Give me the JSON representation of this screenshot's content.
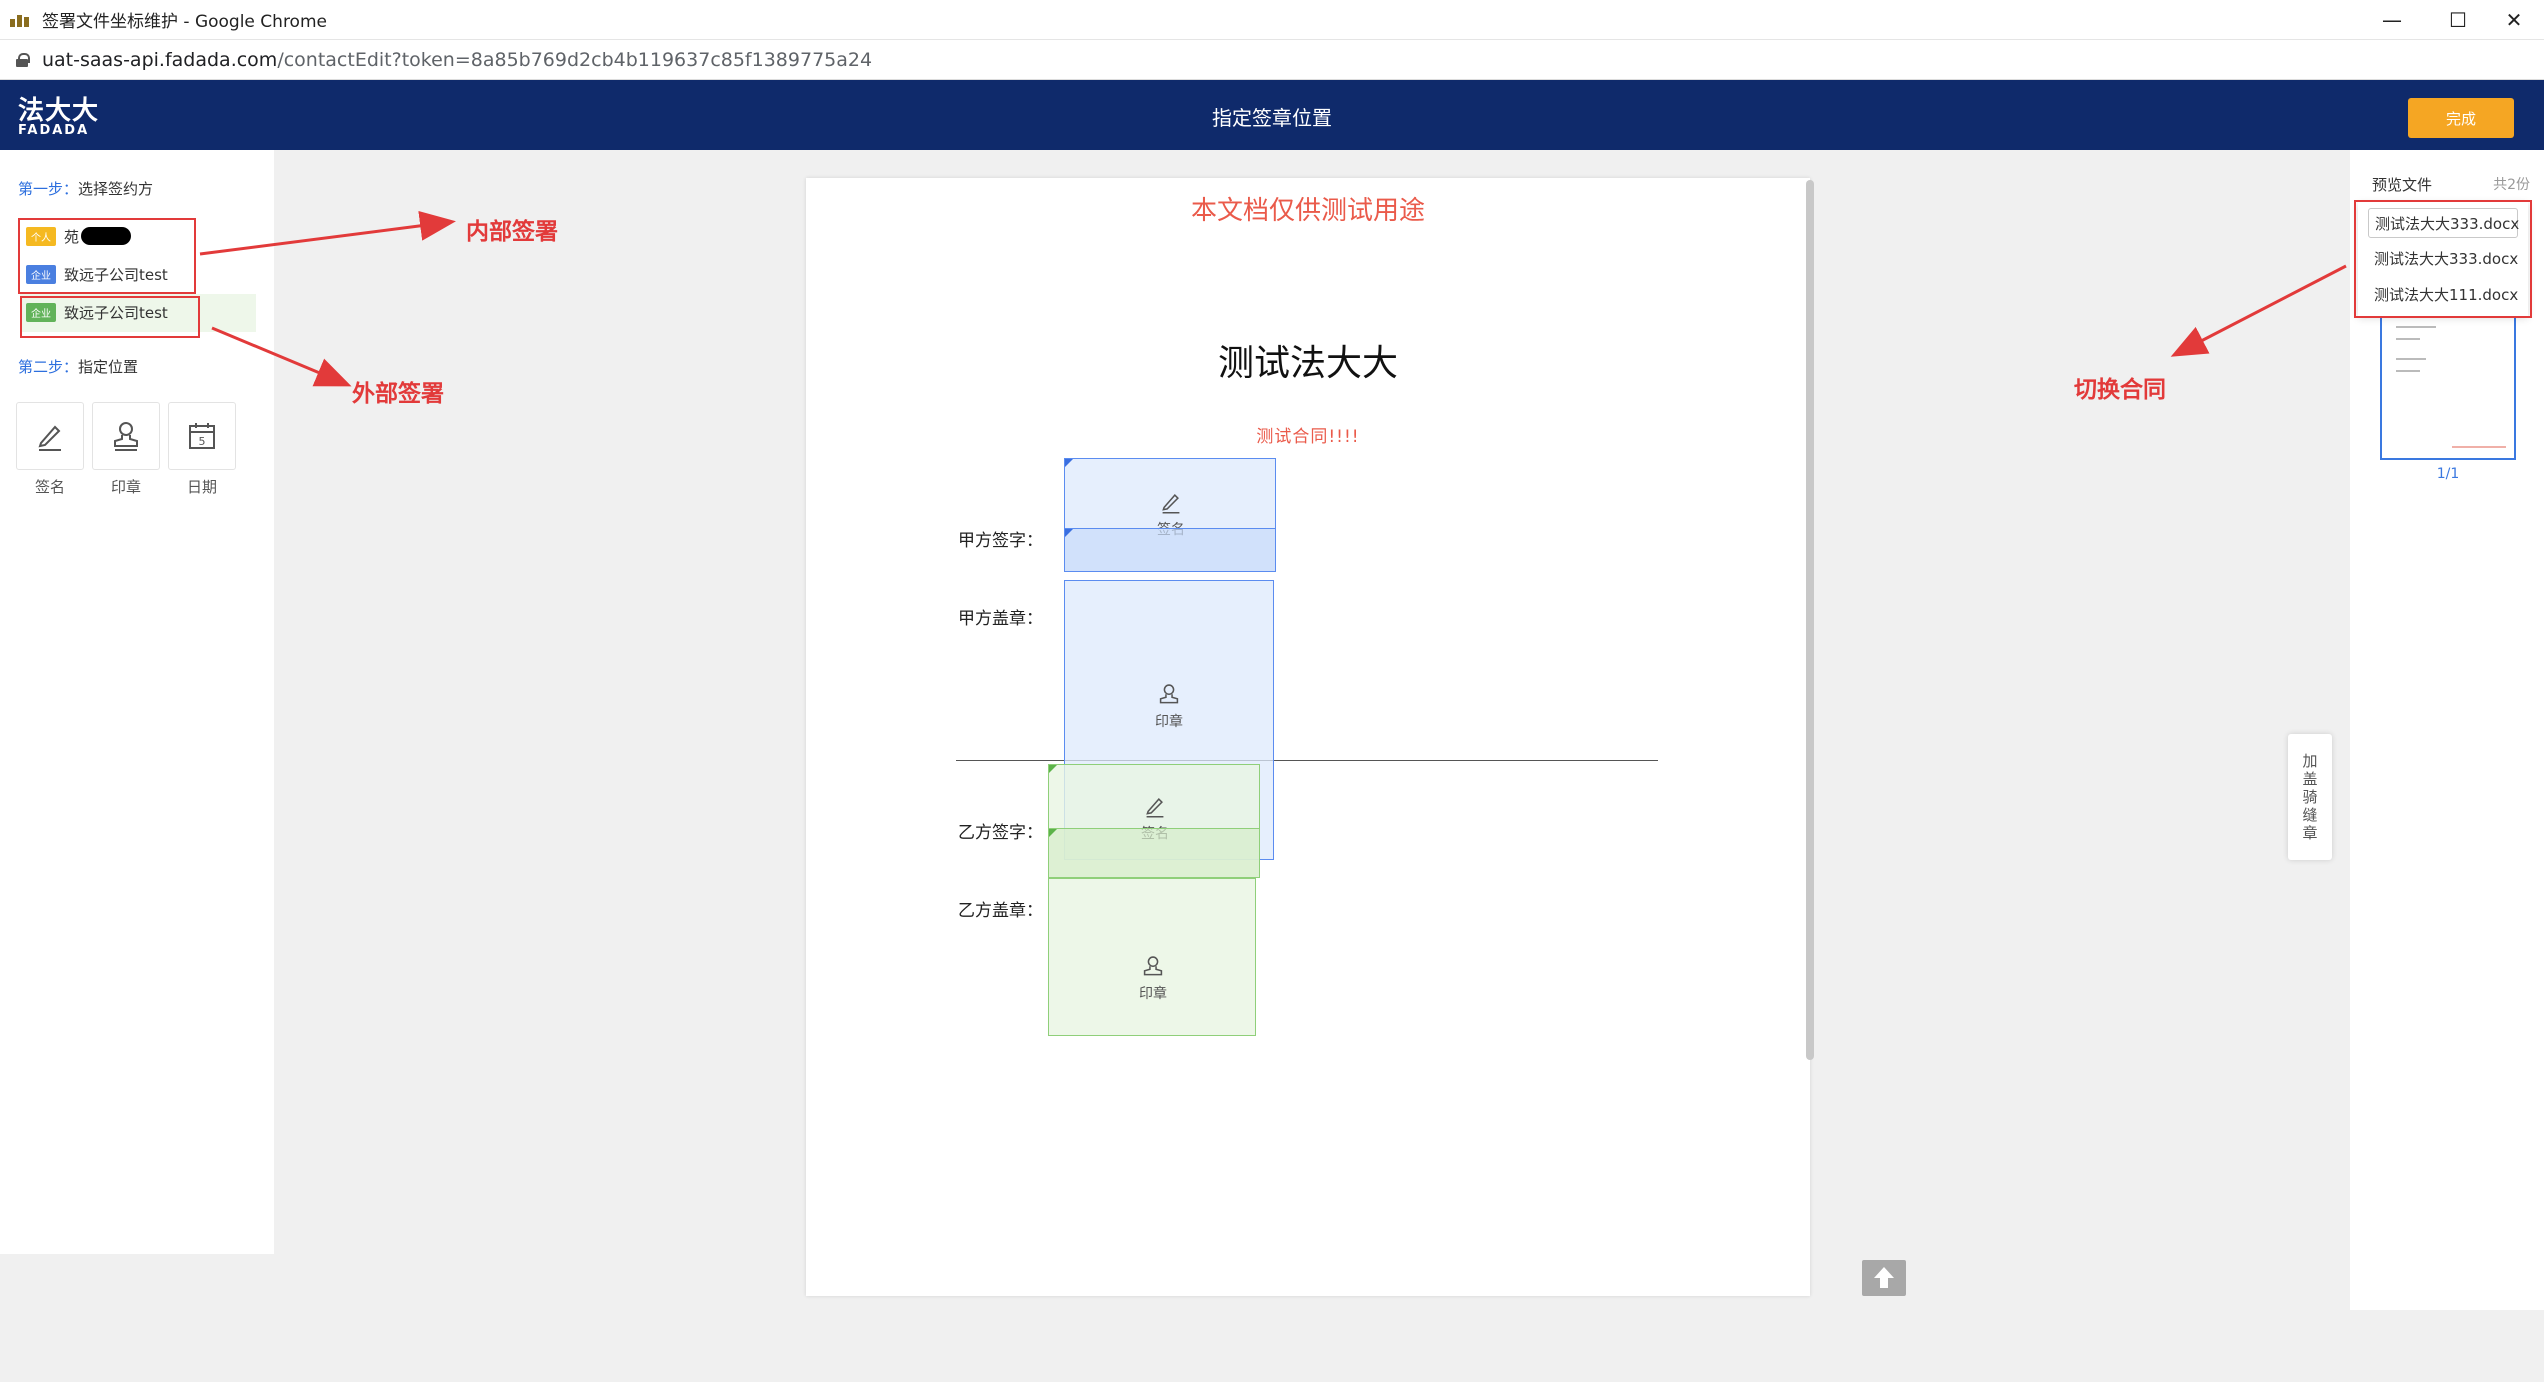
{
  "browser": {
    "window_title": "签署文件坐标维护 - Google Chrome",
    "url_host": "uat-saas-api.fadada.com",
    "url_path": "/contactEdit?token=8a85b769d2cb4b119637c85f1389775a24"
  },
  "header": {
    "logo_cn": "法大大",
    "logo_en": "FADADA",
    "title": "指定签章位置",
    "done_label": "完成"
  },
  "left": {
    "step1_num": "第一步：",
    "step1_text": "选择签约方",
    "parties": [
      {
        "tag": "个人",
        "name": "苑"
      },
      {
        "tag": "企业",
        "name": "致远子公司test"
      },
      {
        "tag": "企业",
        "name": "致远子公司test"
      }
    ],
    "step2_num": "第二步：",
    "step2_text": "指定位置",
    "tools": [
      {
        "label": "签名",
        "icon": "pen-icon"
      },
      {
        "label": "印章",
        "icon": "stamp-icon"
      },
      {
        "label": "日期",
        "icon": "calendar-icon",
        "day": "5"
      }
    ]
  },
  "document": {
    "watermark": "本文档仅供测试用途",
    "title": "测试法大大",
    "subtitle": "测试合同!!!!",
    "party_a_sign": "甲方签字：",
    "party_a_seal": "甲方盖章：",
    "party_b_sign": "乙方签字：",
    "party_b_seal": "乙方盖章：",
    "field_sign": "签名",
    "field_seal": "印章"
  },
  "right": {
    "preview_title": "预览文件",
    "preview_count": "共2份",
    "files": [
      "测试法大大333.docx",
      "测试法大大333.docx",
      "测试法大大111.docx"
    ],
    "page": "1/1",
    "float_button": "加盖骑缝章"
  },
  "annotations": {
    "internal": "内部签署",
    "external": "外部签署",
    "switch": "切换合同"
  },
  "colors": {
    "header_bg": "#0f2a6b",
    "done_button": "#f5a623",
    "annotation_red": "#e23a3a",
    "step_blue": "#2d6fde"
  }
}
